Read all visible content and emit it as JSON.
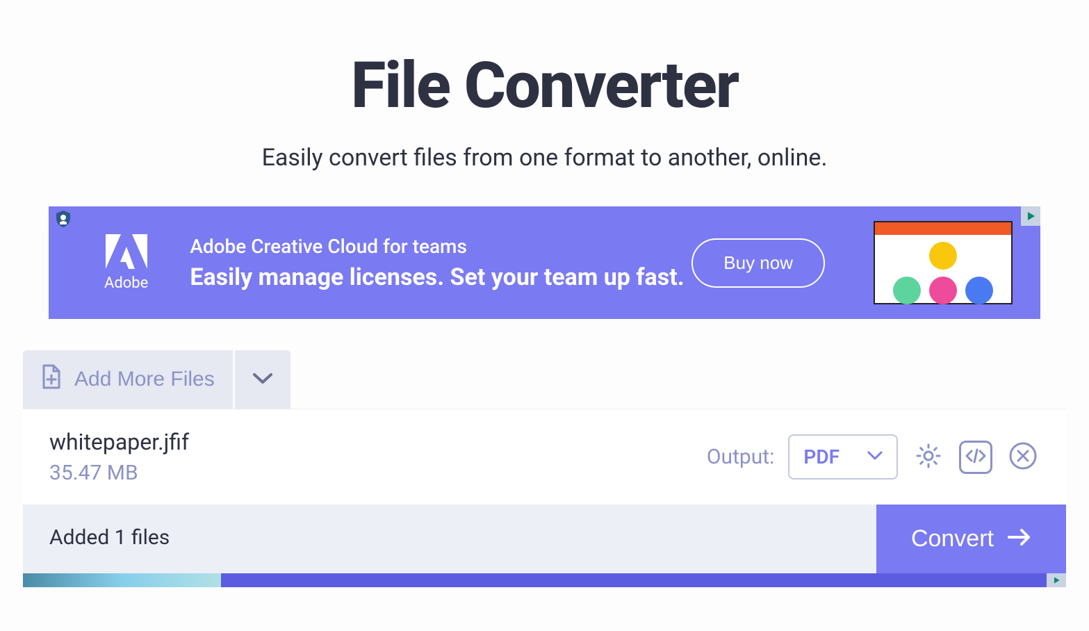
{
  "page": {
    "title": "File Converter",
    "subtitle": "Easily convert files from one format to another, online."
  },
  "ad": {
    "brand": "Adobe",
    "line1": "Adobe Creative Cloud for teams",
    "line2": "Easily manage licenses. Set your team up fast.",
    "cta": "Buy now"
  },
  "addFiles": {
    "label": "Add More Files"
  },
  "file": {
    "name": "whitepaper.jfif",
    "size": "35.47 MB",
    "outputLabel": "Output:",
    "formatSelected": "PDF"
  },
  "footer": {
    "status": "Added 1 files",
    "convertLabel": "Convert"
  }
}
